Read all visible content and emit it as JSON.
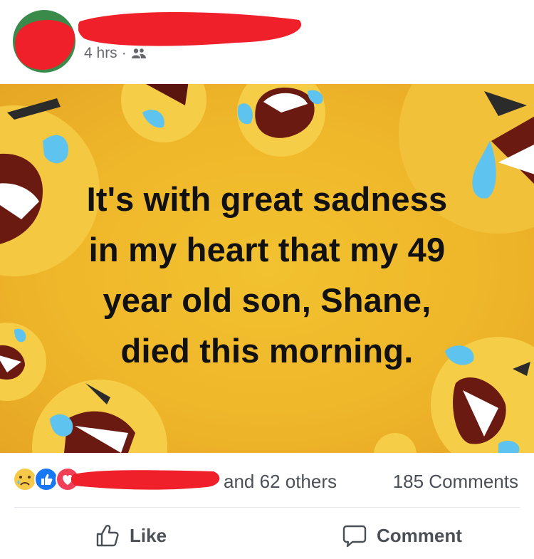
{
  "post": {
    "timestamp": "4 hrs",
    "separator": "·",
    "audience_icon": "friends-icon",
    "image_text_lines": [
      "It's with great sadness",
      "in my heart that my 49",
      "year old son, Shane,",
      "died this morning."
    ]
  },
  "reactions": {
    "icons": [
      "sad-reaction-icon",
      "like-reaction-icon",
      "love-reaction-icon"
    ],
    "others_text": "and 62 others",
    "comments_text": "185 Comments"
  },
  "actions": {
    "like_label": "Like",
    "comment_label": "Comment"
  },
  "colors": {
    "background_yellow": "#efb72a",
    "redaction_red": "#f0202a",
    "like_blue": "#1877f2",
    "love_red": "#f33e58"
  }
}
